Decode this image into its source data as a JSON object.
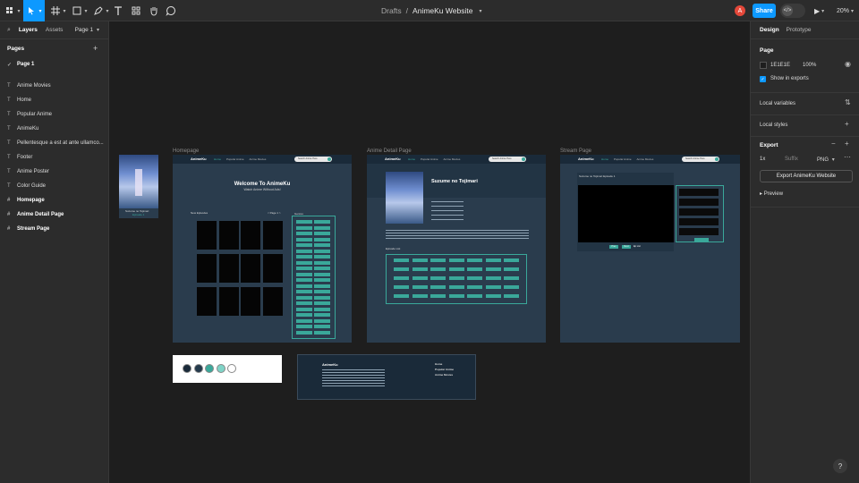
{
  "toolbar": {
    "crumb_drafts": "Drafts",
    "crumb_sep": "/",
    "file_name": "AnimeKu Website",
    "avatar_letter": "A",
    "share_label": "Share",
    "dev_label": "</>",
    "zoom_label": "20%"
  },
  "left_panel": {
    "tab_layers": "Layers",
    "tab_assets": "Assets",
    "page_selector": "Page 1",
    "pages_heading": "Pages",
    "pages": [
      {
        "label": "Page 1",
        "current": true
      },
      {
        "label": "Anime Movies"
      },
      {
        "label": "Home"
      },
      {
        "label": "Popular Anime"
      },
      {
        "label": "AnimeKu"
      },
      {
        "label": "Pellentesque a est at ante ullamco..."
      },
      {
        "label": "Footer"
      },
      {
        "label": "Anime Poster"
      },
      {
        "label": "Color Guide"
      },
      {
        "label": "Homepage"
      },
      {
        "label": "Anime Detail Page"
      },
      {
        "label": "Stream Page"
      }
    ]
  },
  "right_panel": {
    "tab_design": "Design",
    "tab_prototype": "Prototype",
    "page_heading": "Page",
    "page_color": "1E1E1E",
    "page_opacity": "100%",
    "show_exports": "Show in exports",
    "local_variables": "Local variables",
    "local_styles": "Local styles",
    "export_heading": "Export",
    "export_scale": "1x",
    "export_suffix": "Suffix",
    "export_format": "PNG",
    "export_button": "Export AnimeKu Website",
    "preview": "Preview"
  },
  "canvas": {
    "frame_homepage": "Homepage",
    "frame_detail": "Anime Detail Page",
    "frame_stream": "Stream Page",
    "poster_title": "Suzume no Tojimari",
    "poster_sub": "Episode 1",
    "nav_logo": "AnimeKu",
    "nav_home": "Home",
    "nav_popular": "Popular Anime",
    "nav_movies": "Anime Movies",
    "nav_search": "Search Anime Here",
    "home_title": "Welcome To AnimeKu",
    "home_subtitle": "Watch Anime Without Ads!",
    "home_new_episodes": "New Episodes",
    "home_pager": "< Page 1 >",
    "home_genres": "Genres",
    "detail_title": "Suzume no Tojimari",
    "detail_episode_list": "Episode List",
    "stream_title": "Suzume no Tojimari Episode 1",
    "stream_prev": "Prev",
    "stream_next": "Next",
    "stream_list": "Ep List",
    "footer_logo": "AnimeKu",
    "footer_home": "Home",
    "footer_popular": "Popular Anime",
    "footer_movies": "Anime Movies",
    "colors": [
      "#1a2a39",
      "#243a4c",
      "#3aa89a",
      "#7fd4c7",
      "#ffffff"
    ]
  }
}
